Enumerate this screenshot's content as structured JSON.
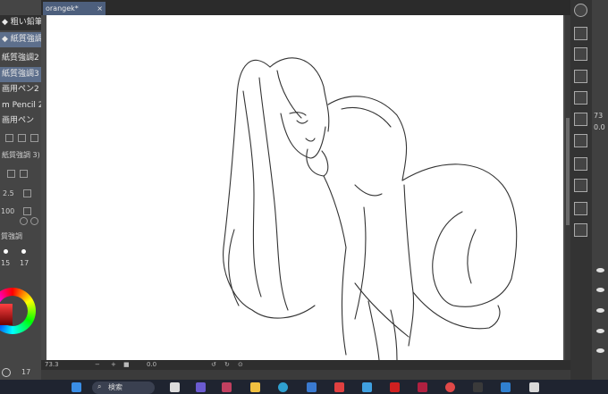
{
  "document": {
    "tab_label": "orangek*",
    "close_glyph": "×"
  },
  "sub_tools": [
    "粗い鉛筆",
    "紙質強調",
    "紙質強調2",
    "紙質強調3",
    "画用ペン2",
    "m Pencil 2",
    "画用ペン"
  ],
  "left_panel": {
    "selected_tool_label": "紙質強調 3)",
    "brush_size": "2.5",
    "opacity": "100",
    "tool_group_label": "質強調",
    "dot_size_a": "15",
    "dot_size_b": "17",
    "color_value": "17"
  },
  "status_bar": {
    "zoom": "73.3",
    "angle": "0.0"
  },
  "right_edge": {
    "value_a": "73",
    "value_b": "0.0"
  },
  "taskbar": {
    "search_label": "検索"
  },
  "colors": {
    "selection": "#5d6f8c",
    "accent_tab": "#4d5f7d",
    "canvas": "#ffffff"
  }
}
